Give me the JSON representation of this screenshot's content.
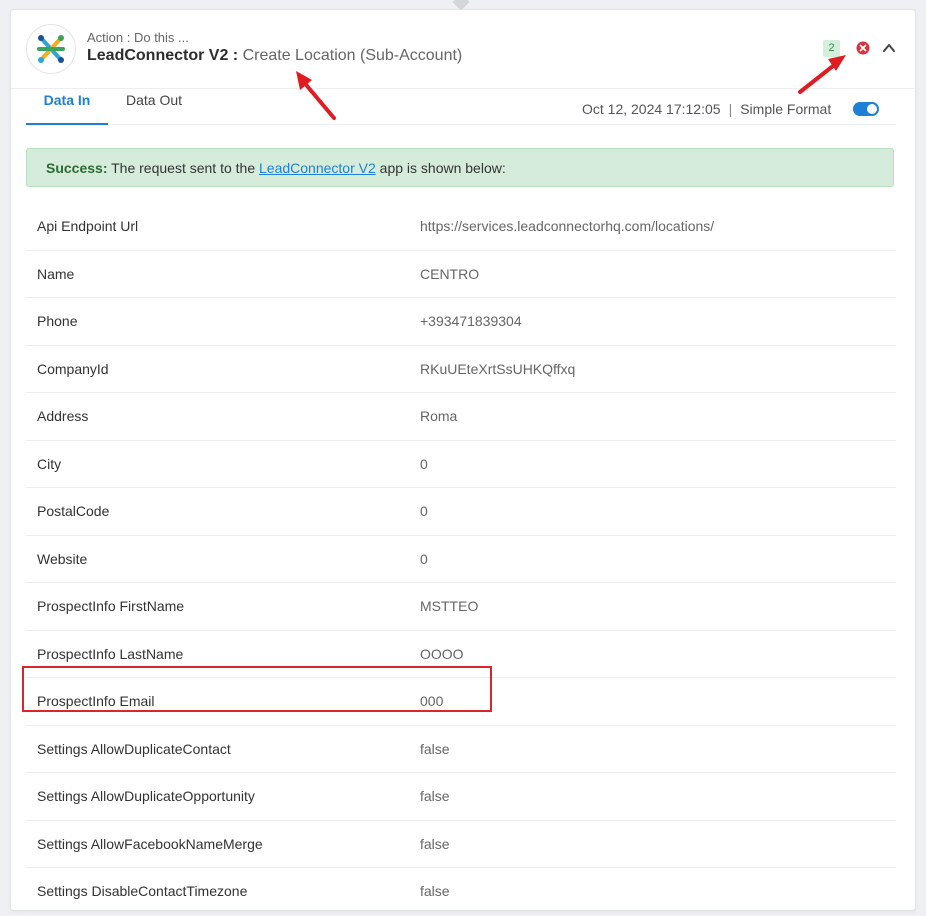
{
  "header": {
    "action_label": "Action : Do this ...",
    "app_name": "LeadConnector V2",
    "separator": " : ",
    "event_name": "Create Location (Sub-Account)",
    "count_badge": "2"
  },
  "tabs": [
    {
      "label": "Data In",
      "active": true
    },
    {
      "label": "Data Out",
      "active": false
    }
  ],
  "meta": {
    "timestamp": "Oct 12, 2024 17:12:05",
    "separator": "|",
    "format_label": "Simple Format",
    "format_on": true
  },
  "alert": {
    "strong": "Success:",
    "prefix": " The request sent to the ",
    "link": "LeadConnector V2",
    "suffix": " app is shown below:"
  },
  "rows": [
    {
      "key": "Api Endpoint Url",
      "value": "https://services.leadconnectorhq.com/locations/"
    },
    {
      "key": "Name",
      "value": "CENTRO"
    },
    {
      "key": "Phone",
      "value": "+393471839304"
    },
    {
      "key": "CompanyId",
      "value": "RKuUEteXrtSsUHKQffxq"
    },
    {
      "key": "Address",
      "value": "Roma"
    },
    {
      "key": "City",
      "value": "0"
    },
    {
      "key": "PostalCode",
      "value": "0"
    },
    {
      "key": "Website",
      "value": "0"
    },
    {
      "key": "ProspectInfo FirstName",
      "value": "MSTTEO"
    },
    {
      "key": "ProspectInfo LastName",
      "value": "OOOO"
    },
    {
      "key": "ProspectInfo Email",
      "value": "000"
    },
    {
      "key": "Settings AllowDuplicateContact",
      "value": "false"
    },
    {
      "key": "Settings AllowDuplicateOpportunity",
      "value": "false"
    },
    {
      "key": "Settings AllowFacebookNameMerge",
      "value": "false"
    },
    {
      "key": "Settings DisableContactTimezone",
      "value": "false"
    }
  ],
  "colors": {
    "accent": "#1e7fd6",
    "success_bg": "#d6ecda",
    "annotation_red": "#d9262b",
    "error_red": "#d9323a"
  },
  "icons": [
    "app-logo-icon",
    "error-circle-icon",
    "chevron-up-icon",
    "arrow-annotation-icon"
  ]
}
